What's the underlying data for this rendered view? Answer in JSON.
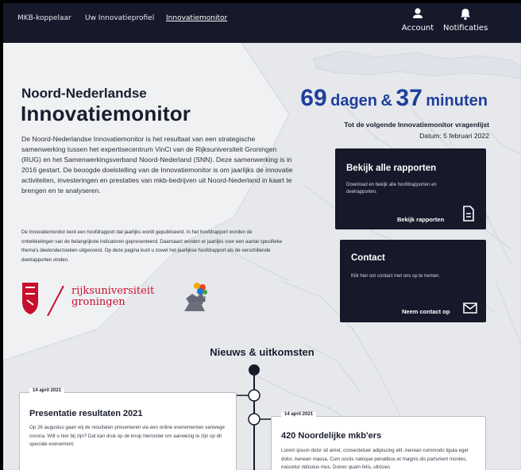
{
  "nav": {
    "links": [
      "MKB-koppelaar",
      "Uw Innovatieprofiel",
      "Innovatiemonitor"
    ],
    "account_label": "Account",
    "notifications_label": "Notificaties"
  },
  "hero": {
    "title_small": "Noord-Nederlandse",
    "title_big": "Innovatiemonitor",
    "intro": "De Noord-Nederlandse Innovatiemonitor is het resultaat van een strategische samenwerking tussen het expertisecentrum VinCi van de Rijksuniversiteit Groningen (RUG) en het Samenwerkingsverband Noord-Nederland (SNN). Deze samenwerking is in 2016 gestart. De beoogde doelstelling van de Innovatiemonitor is om jaarlijks de innovatie activiteiten, investeringen en prestaties van mkb-bedrijven uit Noord-Nederland in kaart te brengen en te analyseren.",
    "intro2": "De Innovatiemonitor kent een hoofdrapport dat jaarlijks wordt gepubliceerd. In het hoofdrapport worden de ontwikkelingen van de belangrijkste indicatoren gepresenteerd. Daarnaast worden er jaarlijks voor een aantal specifieke thema's deelonderzoeken uitgevoerd. Op deze pagina kunt u zowel het jaarlijkse hoofdrapport als de verschillende deelrapporten vinden."
  },
  "countdown": {
    "days": "69",
    "days_unit": "dagen",
    "amp": "&",
    "minutes": "37",
    "minutes_unit": "minuten",
    "label": "Tot de volgende Innovatiemonitor vragenlijst",
    "date": "Datum: 5 februari 2022"
  },
  "cards": {
    "reports": {
      "title": "Bekijk alle rapporten",
      "desc": "Download en bekijk alle hoofdrapporten en deelrapporten.",
      "link": "Bekijk rapporten"
    },
    "contact": {
      "title": "Contact",
      "desc": "Klik hier om contact met ons op te nemen.",
      "link": "Neem contact op"
    }
  },
  "logos": {
    "rug_line1": "rijksuniversiteit",
    "rug_line2": "groningen",
    "snn": "SNN"
  },
  "news": {
    "heading": "Nieuws & uitkomsten",
    "items": [
      {
        "date": "14 april 2021",
        "title": "Presentatie resultaten 2021",
        "text": "Op 26 augustus gaan wij de resultaten presenteren via een online evenementen vanwege corona. Wilt u hier bij zijn? Dat kan druk op de knop hieronder om aanwezig te zijn op dit speciale evenement."
      },
      {
        "date": "14 april 2021",
        "title": "420 Noordelijke mkb'ers",
        "text": "Lorem ipsum dolor sit amet, consectetuer adipiscing elit. Aenean commodo ligula eget dolor. Aenean massa. Cum sociis natoque penatibus et magnis dis parturient montes, nascetur ridiculus mus. Donec quam felis, ultricies"
      }
    ]
  },
  "colors": {
    "nav_bg": "#15192a",
    "accent": "#1f3f9c",
    "card_bg": "#15192a",
    "page_bg": "#f0f1f3"
  }
}
